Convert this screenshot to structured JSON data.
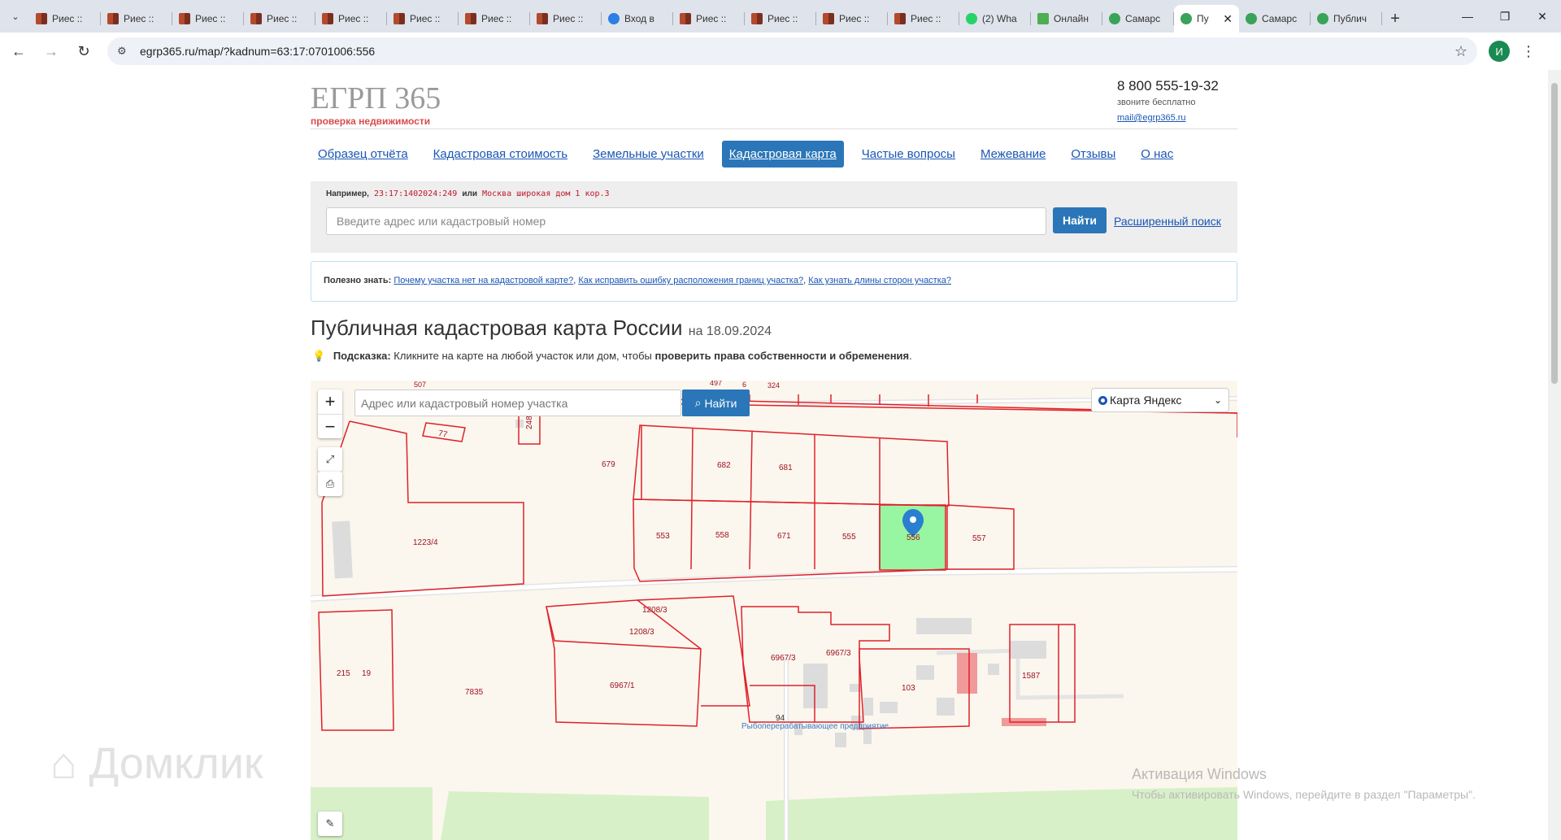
{
  "browser": {
    "tabs": [
      {
        "title": "Риес ::",
        "icon": "grid",
        "active": false
      },
      {
        "title": "Риес ::",
        "icon": "grid",
        "active": false
      },
      {
        "title": "Риес ::",
        "icon": "grid",
        "active": false
      },
      {
        "title": "Риес ::",
        "icon": "grid",
        "active": false
      },
      {
        "title": "Риес ::",
        "icon": "grid",
        "active": false
      },
      {
        "title": "Риес ::",
        "icon": "grid",
        "active": false
      },
      {
        "title": "Риес ::",
        "icon": "grid",
        "active": false
      },
      {
        "title": "Риес ::",
        "icon": "grid",
        "active": false
      },
      {
        "title": "Вход в",
        "icon": "shield",
        "active": false
      },
      {
        "title": "Риес ::",
        "icon": "grid",
        "active": false
      },
      {
        "title": "Риес ::",
        "icon": "grid",
        "active": false
      },
      {
        "title": "Риес ::",
        "icon": "grid",
        "active": false
      },
      {
        "title": "Риес ::",
        "icon": "grid",
        "active": false
      },
      {
        "title": "(2) Wha",
        "icon": "whatsapp",
        "active": false
      },
      {
        "title": "Онлайн",
        "icon": "online",
        "active": false
      },
      {
        "title": "Самарс",
        "icon": "check",
        "active": false
      },
      {
        "title": "Пу",
        "icon": "check",
        "active": true
      },
      {
        "title": "Самарс",
        "icon": "check",
        "active": false
      },
      {
        "title": "Публич",
        "icon": "check",
        "active": false
      }
    ],
    "url": "egrp365.ru/map/?kadnum=63:17:0701006:556",
    "profile_initial": "И"
  },
  "header": {
    "logo": "ЕГРП 365",
    "logo_sub": "проверка недвижимости",
    "phone": "8 800 555-19-32",
    "phone_note": "звоните бесплатно",
    "email": "mail@egrp365.ru"
  },
  "menu": [
    {
      "label": "Образец отчёта",
      "active": false
    },
    {
      "label": "Кадастровая стоимость",
      "active": false
    },
    {
      "label": "Земельные участки",
      "active": false
    },
    {
      "label": "Кадастровая карта",
      "active": true
    },
    {
      "label": "Частые вопросы",
      "active": false
    },
    {
      "label": "Межевание",
      "active": false
    },
    {
      "label": "Отзывы",
      "active": false
    },
    {
      "label": "О нас",
      "active": false
    }
  ],
  "search": {
    "example_label": "Например,",
    "example_1": "23:17:1402024:249",
    "example_or": "или",
    "example_2": "Москва широкая дом 1 кор.3",
    "placeholder": "Введите адрес или кадастровый номер",
    "button": "Найти",
    "advanced": "Расширенный поиск"
  },
  "useful": {
    "label": "Полезно знать:",
    "links": [
      "Почему участка нет на кадастровой карте?",
      "Как исправить ошибку расположения границ участка?",
      "Как узнать длины сторон участка?"
    ]
  },
  "page": {
    "title": "Публичная кадастровая карта России",
    "date": "на 18.09.2024",
    "hint_label": "Подсказка:",
    "hint_text": "Кликните на карте на любой участок или дом, чтобы",
    "hint_bold": "проверить права собственности и обременения",
    "hint_end": "."
  },
  "map": {
    "search_placeholder": "Адрес или кадастровый номер участка",
    "search_button": "Найти",
    "layer": "Карта Яндекс",
    "zoom_in": "+",
    "zoom_out": "−",
    "selected_parcel": "556",
    "highlight_color": "#98f5a2",
    "boundary_color": "#e0202a",
    "parcel_labels": [
      "679",
      "682",
      "681",
      "553",
      "558",
      "671",
      "555",
      "556",
      "557",
      "1223/4",
      "77",
      "248",
      "1208/3",
      "1208/3",
      "6967/3",
      "6967/3",
      "6967/1",
      "103",
      "215",
      "19",
      "7835",
      "1587",
      "94"
    ],
    "top_labels": [
      "507",
      "497",
      "6",
      "324",
      "248"
    ],
    "poi": "Рыбоперерабатывающее предприятие"
  },
  "watermark": {
    "line1": "Активация Windows",
    "line2": "Чтобы активировать Windows, перейдите в раздел \"Параметры\".",
    "brand": "Домклик"
  }
}
